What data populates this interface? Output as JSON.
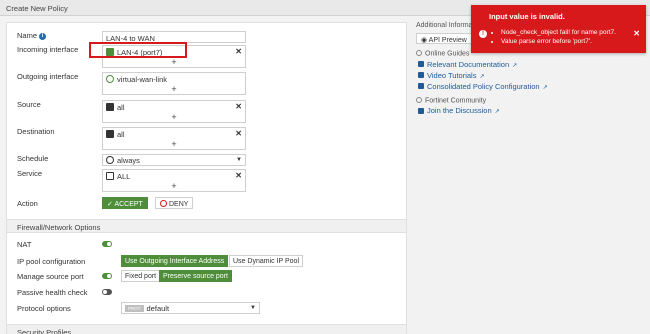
{
  "window_title": "Create New Policy",
  "form": {
    "name_label": "Name",
    "name_value": "LAN-4 to WAN",
    "incoming_label": "Incoming interface",
    "incoming_value": "LAN-4 (port7)",
    "outgoing_label": "Outgoing interface",
    "outgoing_value": "virtual-wan-link",
    "source_label": "Source",
    "source_value": "all",
    "destination_label": "Destination",
    "destination_value": "all",
    "schedule_label": "Schedule",
    "schedule_value": "always",
    "service_label": "Service",
    "service_value": "ALL",
    "action_label": "Action",
    "accept_label": "ACCEPT",
    "deny_label": "DENY",
    "plus_glyph": "+",
    "remove_glyph": "✕"
  },
  "firewall": {
    "section_title": "Firewall/Network Options",
    "nat_label": "NAT",
    "nat_enabled": true,
    "ip_pool_label": "IP pool configuration",
    "ip_pool_options": [
      "Use Outgoing Interface Address",
      "Use Dynamic IP Pool"
    ],
    "ip_pool_selected": "Use Outgoing Interface Address",
    "manage_port_label": "Manage source port",
    "manage_port_enabled": true,
    "port_options": [
      "Fixed port",
      "Preserve source port"
    ],
    "port_selected": "Preserve source port",
    "passive_label": "Passive health check",
    "passive_enabled": false,
    "protocol_label": "Protocol options",
    "protocol_badge": "PROT",
    "protocol_value": "default"
  },
  "security_profiles_title": "Security Profiles",
  "sidebar": {
    "additional_info": "Additional Information",
    "api_preview": "API Preview",
    "online_guides": "Online Guides",
    "links": [
      "Relevant Documentation",
      "Video Tutorials",
      "Consolidated Policy Configuration"
    ],
    "community": "Fortinet Community",
    "community_link": "Join the Discussion"
  },
  "toast": {
    "title": "Input value is invalid.",
    "messages": [
      "Node_check_object fail! for name port7.",
      "Value parse error before 'port7'."
    ],
    "close": "✕"
  },
  "colors": {
    "accent_green": "#4e8e3b",
    "error_red": "#d7191c",
    "link_blue": "#1f5a99"
  }
}
